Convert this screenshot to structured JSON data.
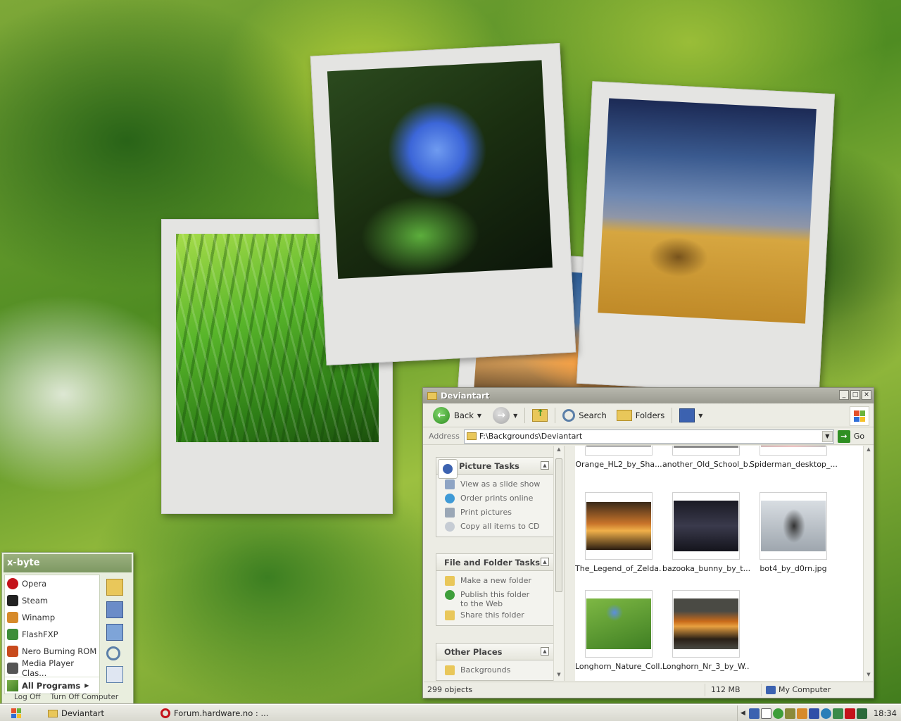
{
  "start_menu": {
    "user": "x-byte",
    "programs": [
      {
        "label": "Opera",
        "icon": "opera-icon",
        "color": "#c4121a"
      },
      {
        "label": "Steam",
        "icon": "steam-icon",
        "color": "#222222"
      },
      {
        "label": "Winamp",
        "icon": "winamp-icon",
        "color": "#d68a2a"
      },
      {
        "label": "FlashFXP",
        "icon": "flashfxp-icon",
        "color": "#3e8e3a"
      },
      {
        "label": "Nero Burning ROM",
        "icon": "nero-icon",
        "color": "#c84a1c"
      },
      {
        "label": "Media Player Clas...",
        "icon": "media-player-icon",
        "color": "#555555"
      }
    ],
    "all_programs": "All Programs",
    "log_off": "Log Off",
    "turn_off": "Turn Off Computer"
  },
  "window": {
    "title": "Deviantart",
    "toolbar": {
      "back": "Back",
      "search": "Search",
      "folders": "Folders"
    },
    "address": {
      "label": "Address",
      "value": "F:\\Backgrounds\\Deviantart",
      "go": "Go"
    },
    "picture_tasks": {
      "title": "Picture Tasks",
      "items": [
        "View as a slide show",
        "Order prints online",
        "Print pictures",
        "Copy all items to CD"
      ]
    },
    "file_folder_tasks": {
      "title": "File and Folder Tasks",
      "items": [
        "Make a new folder",
        "Publish this folder to the Web",
        "Share this folder"
      ]
    },
    "other_places": {
      "title": "Other Places",
      "items": [
        "Backgrounds"
      ]
    },
    "files": [
      {
        "name": "Orange_HL2_by_Sha..."
      },
      {
        "name": "another_Old_School_b..."
      },
      {
        "name": "Spiderman_desktop_..."
      },
      {
        "name": "The_Legend_of_Zelda..."
      },
      {
        "name": "bazooka_bunny_by_t..."
      },
      {
        "name": "bot4_by_d0rn.jpg"
      },
      {
        "name": "Longhorn_Nature_Coll..."
      },
      {
        "name": "Longhorn_Nr_3_by_W..."
      }
    ],
    "status": {
      "objects": "299 objects",
      "size": "112 MB",
      "location": "My Computer"
    }
  },
  "taskbar": {
    "tasks": [
      {
        "label": "Deviantart"
      },
      {
        "label": "Forum.hardware.no : ..."
      }
    ],
    "clock": "18:34"
  }
}
